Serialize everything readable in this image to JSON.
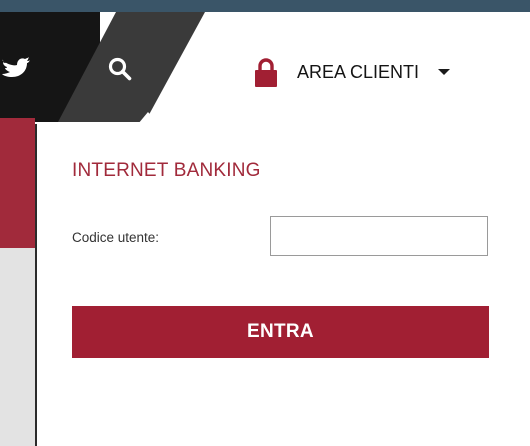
{
  "header": {
    "account_menu_label": "AREA CLIENTI",
    "icons": [
      "twitter-icon",
      "search-icon",
      "lock-icon",
      "chevron-down-icon"
    ]
  },
  "login_panel": {
    "title": "INTERNET BANKING",
    "user_code_label": "Codice utente:",
    "user_code_value": "",
    "submit_label": "ENTRA"
  },
  "colors": {
    "brand_red": "#a11f33",
    "top_strip": "#3a5568",
    "social_dark": "#151515",
    "search_dark": "#3a3a3a"
  }
}
